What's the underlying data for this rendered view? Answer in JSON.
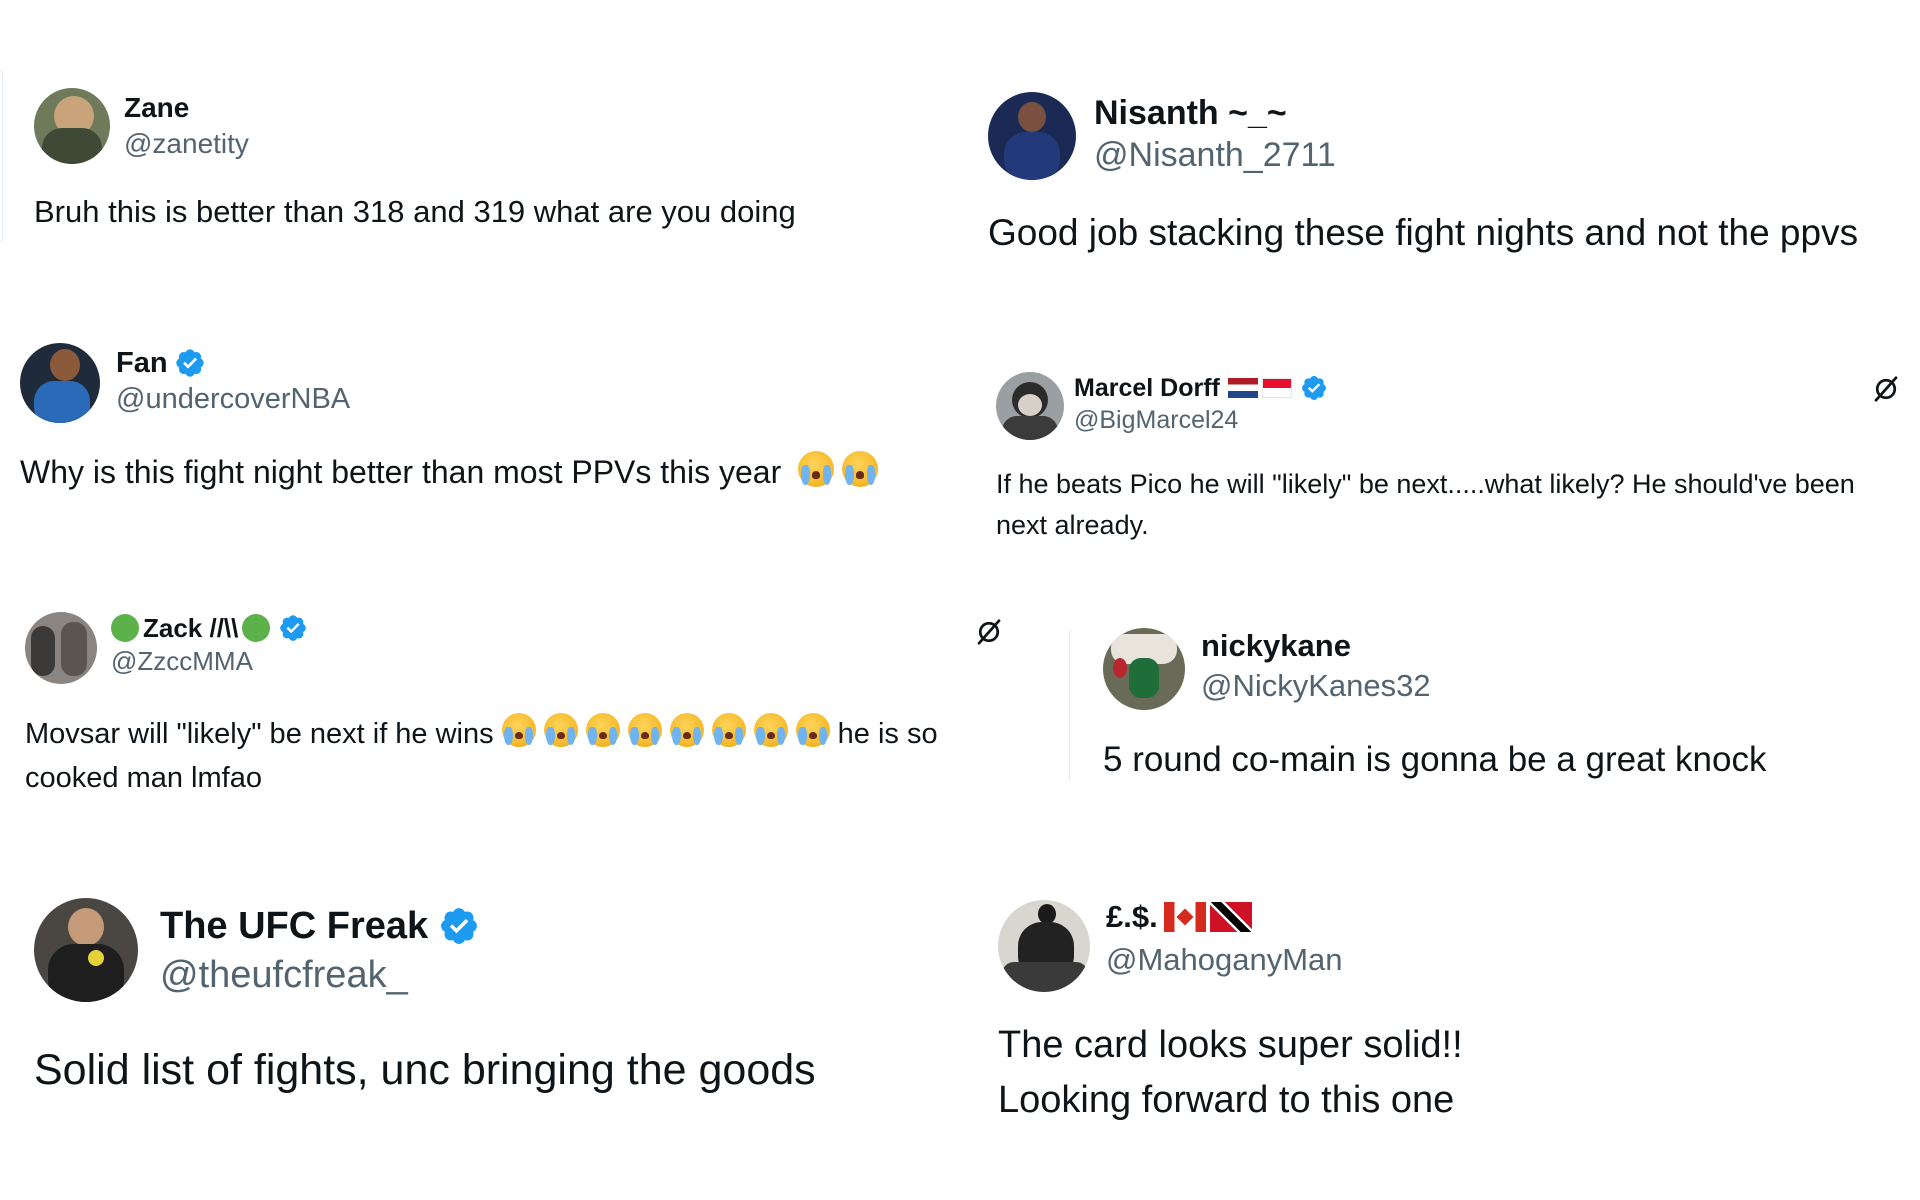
{
  "colors": {
    "text": "#0f1419",
    "handle": "#536471",
    "verified": "#1d9bf0"
  },
  "tweets": [
    {
      "name": "Zane",
      "handle": "@zanetity",
      "verified": false,
      "text": "Bruh this is better than 318 and 319 what are you doing"
    },
    {
      "name": "Nisanth ~_~",
      "handle": "@Nisanth_2711",
      "verified": false,
      "text": "Good job stacking these fight nights and not the ppvs"
    },
    {
      "name": "Fan",
      "handle": "@undercoverNBA",
      "verified": true,
      "text": "Why is this fight night better than most PPVs this year",
      "emoji_count": 2,
      "emoji": "loudly-crying-face"
    },
    {
      "name": "Marcel Dorff",
      "handle": "@BigMarcel24",
      "verified": true,
      "flags": [
        "netherlands-flag",
        "indonesia-flag"
      ],
      "text_lines": [
        "If he beats Pico he will \"likely\" be next.....what likely? He should've been",
        "next already."
      ]
    },
    {
      "name": "Zack //\\\\",
      "handle": "@ZzccMMA",
      "verified": true,
      "text_before": "Movsar will \"likely\" be next if he wins",
      "emoji_count": 8,
      "emoji": "loudly-crying-face",
      "text_after": "he is so",
      "text_line2": "cooked man lmfao"
    },
    {
      "name": "nickykane",
      "handle": "@NickyKanes32",
      "verified": false,
      "text": "5 round co-main is gonna be a great knock"
    },
    {
      "name": "The UFC Freak",
      "handle": "@theufcfreak_",
      "verified": true,
      "text": "Solid list of fights, unc bringing the goods"
    },
    {
      "name": "£.$.",
      "handle": "@MahoganyMan",
      "verified": false,
      "flags": [
        "canada-flag",
        "trinidad-and-tobago-flag"
      ],
      "text_lines": [
        "The card looks super solid!!",
        "Looking forward to this one"
      ]
    }
  ]
}
